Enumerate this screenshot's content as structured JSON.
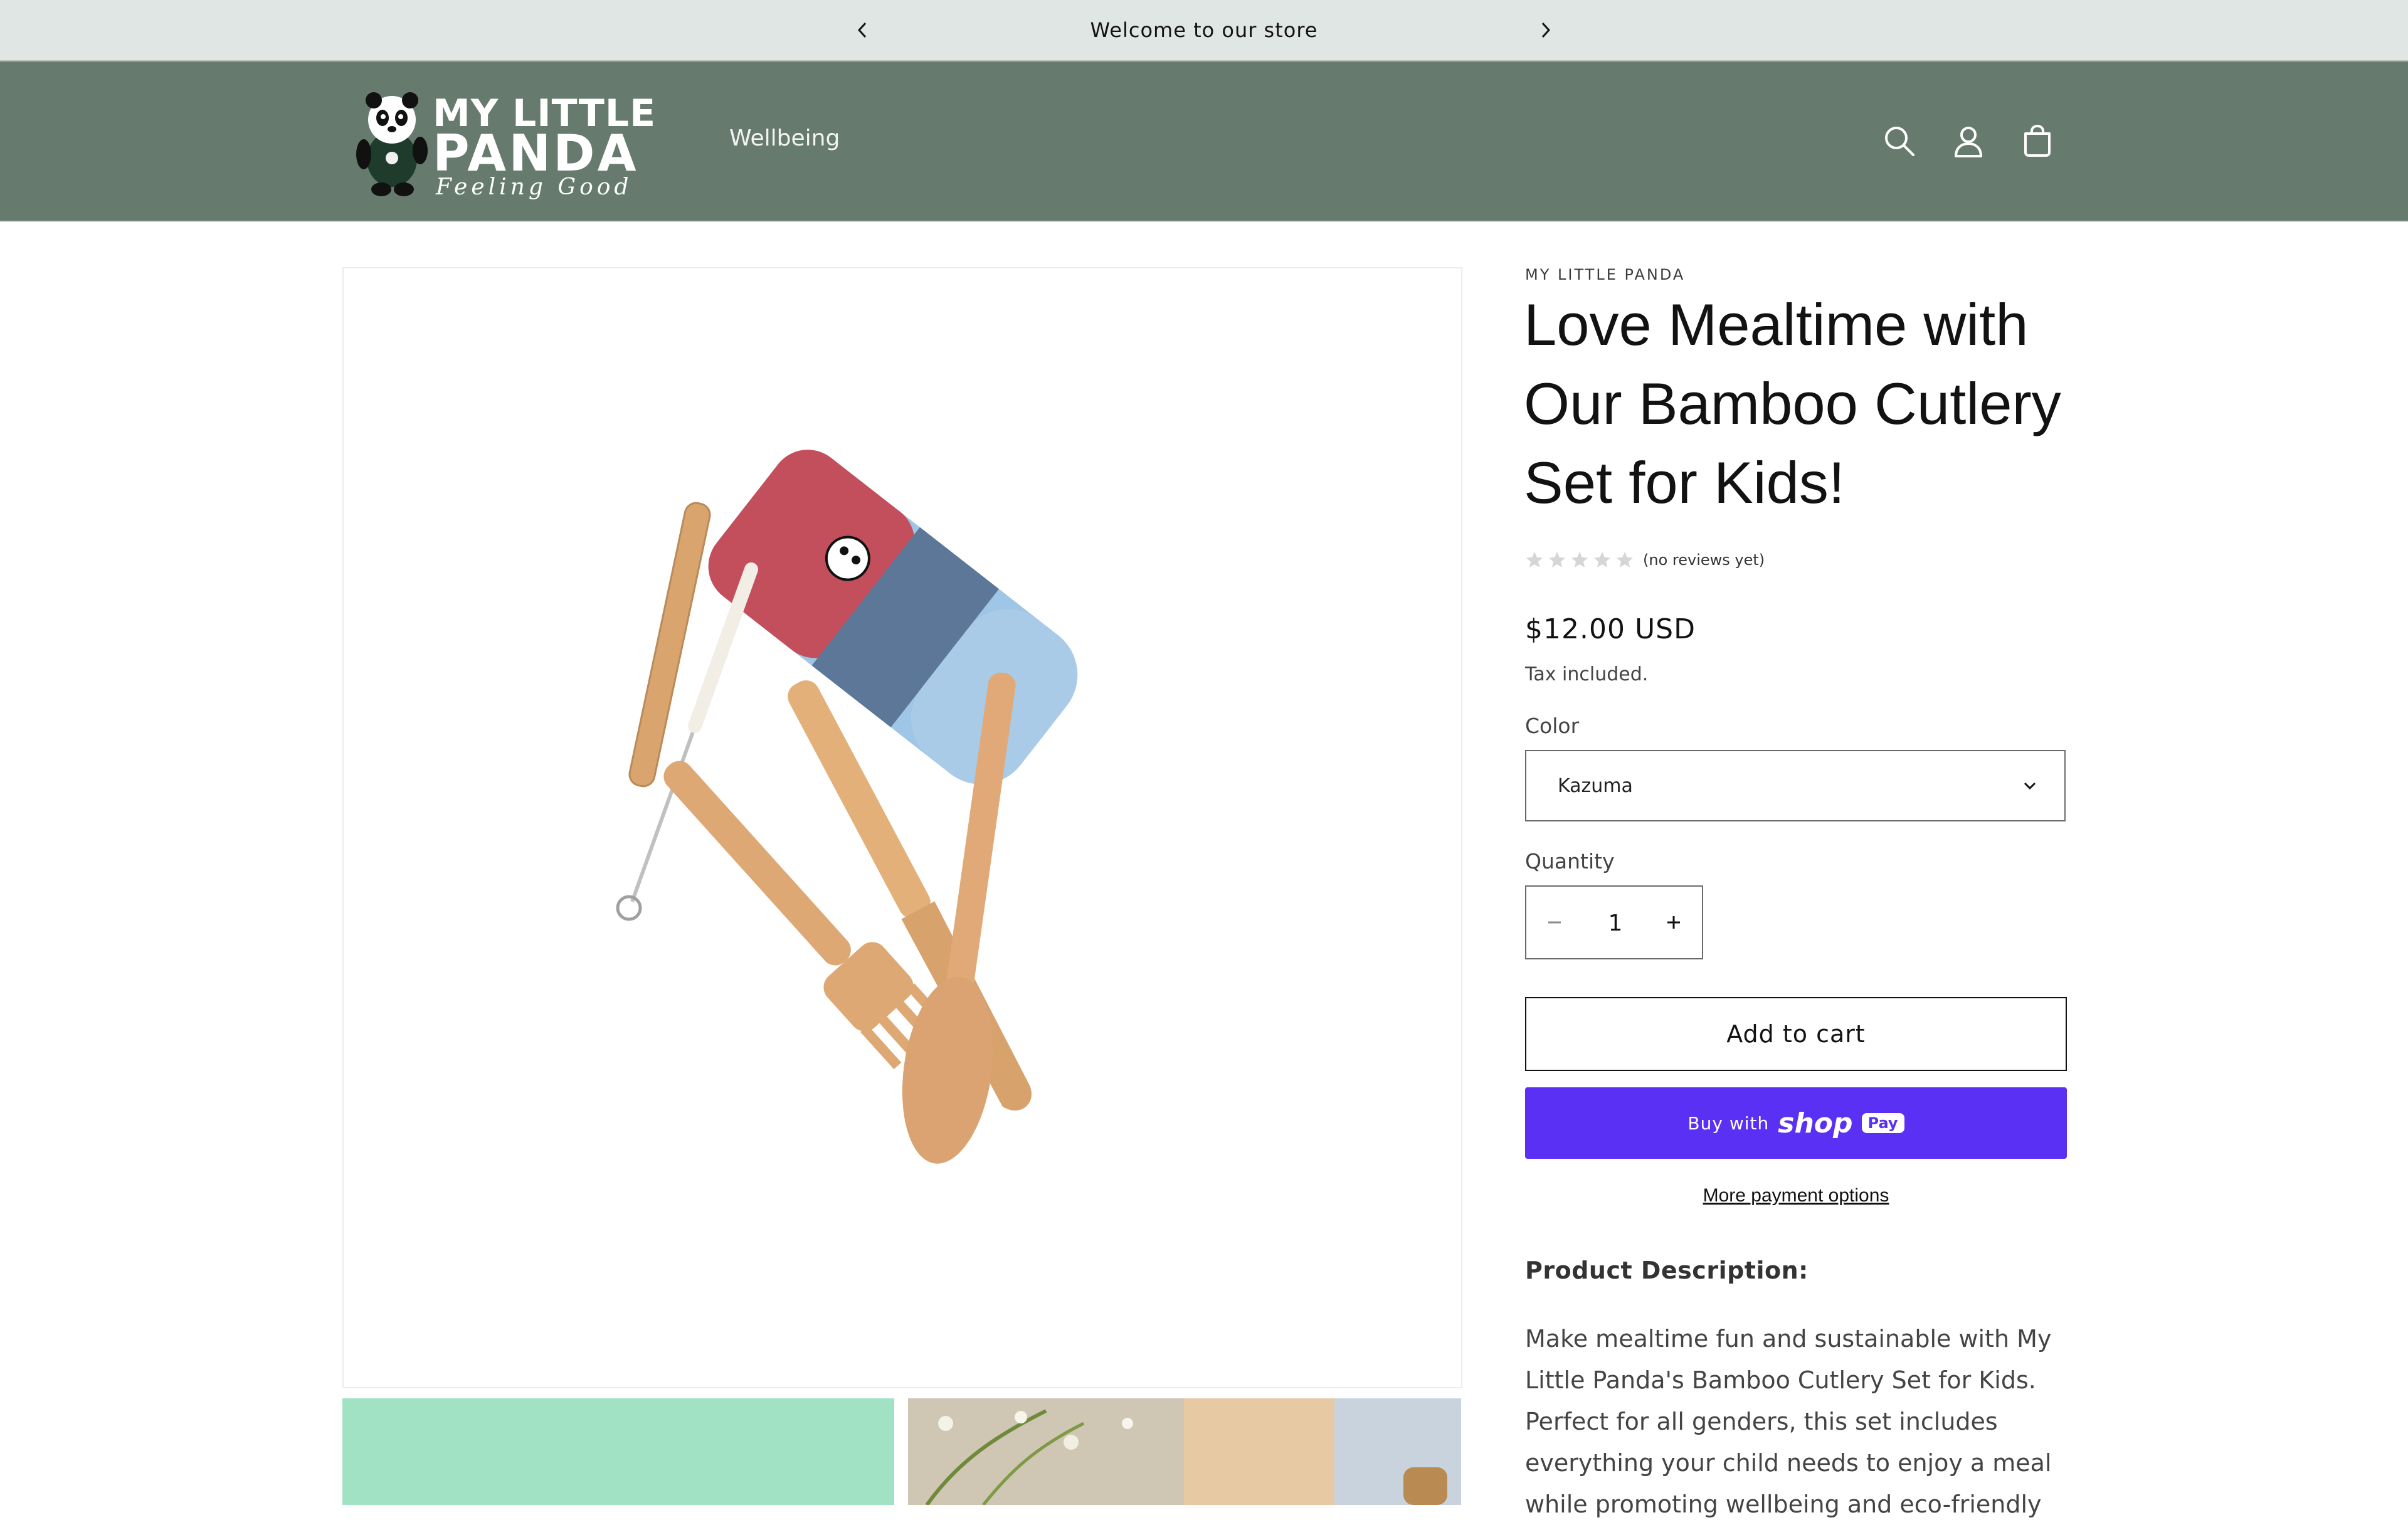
{
  "announcement": {
    "text": "Welcome to our store",
    "prev_icon": "chevron-left-icon",
    "next_icon": "chevron-right-icon"
  },
  "header": {
    "logo": {
      "line1": "MY LITTLE",
      "line2": "PANDA",
      "tagline": "Feeling Good"
    },
    "nav": [
      {
        "label": "Wellbeing"
      }
    ],
    "icons": [
      "search-icon",
      "account-icon",
      "cart-icon"
    ]
  },
  "product": {
    "vendor": "MY LITTLE PANDA",
    "title": "Love Mealtime with Our Bamboo Cutlery Set for Kids!",
    "rating": {
      "value": 0,
      "max": 5,
      "text": "(no reviews yet)"
    },
    "price": "$12.00 USD",
    "tax_note": "Tax included.",
    "color": {
      "label": "Color",
      "selected": "Kazuma"
    },
    "quantity": {
      "label": "Quantity",
      "value": "1"
    },
    "add_to_cart": "Add to cart",
    "shop_pay": {
      "prefix": "Buy with",
      "brand": "shop",
      "badge": "Pay"
    },
    "more_payment": "More payment options",
    "description_heading": "Product Description:",
    "description": "Make mealtime fun and sustainable with My Little Panda's Bamboo Cutlery Set for Kids. Perfect for all genders, this set includes everything your child needs to enjoy a meal while promoting wellbeing and eco-friendly"
  },
  "colors": {
    "announcement_bg": "#e0e6e3",
    "header_bg": "#667b6e",
    "shop_pay": "#5a31f4"
  }
}
